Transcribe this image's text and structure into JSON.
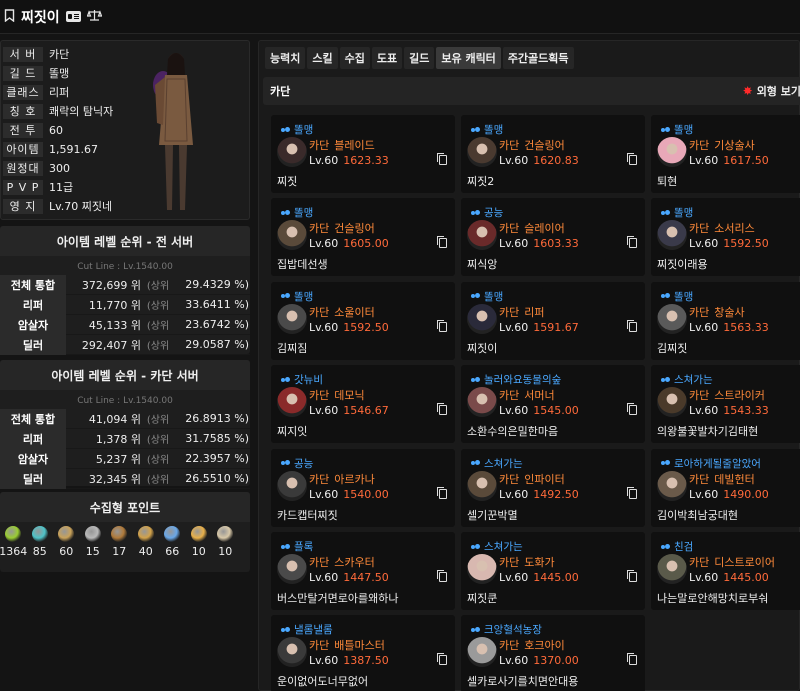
{
  "header": {
    "title": "찌짓이"
  },
  "profile": {
    "rows": [
      {
        "label": "서 버",
        "value": "카단"
      },
      {
        "label": "길 드",
        "value": "똘맹"
      },
      {
        "label": "클래스",
        "value": "리퍼"
      },
      {
        "label": "칭 호",
        "value": "쾌락의 탐닉자"
      },
      {
        "label": "전 투",
        "value": "60"
      },
      {
        "label": "아이템",
        "value": "1,591.67"
      },
      {
        "label": "원정대",
        "value": "300"
      },
      {
        "label": "P V P",
        "value": "11급"
      },
      {
        "label": "영 지",
        "value": "Lv.70 찌짓네"
      }
    ]
  },
  "rank_all": {
    "title": "아이템 레벨 순위 - 전 서버",
    "cutline": "Cut Line : Lv.1540.00",
    "rows": [
      {
        "label": "전체 통합",
        "pos": "372,699 위",
        "sang": "(상위",
        "pct": "29.4329 %)"
      },
      {
        "label": "리퍼",
        "pos": "11,770 위",
        "sang": "(상위",
        "pct": "33.6411 %)"
      },
      {
        "label": "암살자",
        "pos": "45,133 위",
        "sang": "(상위",
        "pct": "23.6742 %)"
      },
      {
        "label": "딜러",
        "pos": "292,407 위",
        "sang": "(상위",
        "pct": "29.0587 %)"
      }
    ]
  },
  "rank_server": {
    "title": "아이템 레벨 순위 - 카단 서버",
    "cutline": "Cut Line : Lv.1540.00",
    "rows": [
      {
        "label": "전체 통합",
        "pos": "41,094 위",
        "sang": "(상위",
        "pct": "26.8913 %)"
      },
      {
        "label": "리퍼",
        "pos": "1,378 위",
        "sang": "(상위",
        "pct": "31.7585 %)"
      },
      {
        "label": "암살자",
        "pos": "5,237 위",
        "sang": "(상위",
        "pct": "22.3957 %)"
      },
      {
        "label": "딜러",
        "pos": "32,345 위",
        "sang": "(상위",
        "pct": "26.5510 %)"
      }
    ]
  },
  "collect": {
    "title": "수집형 포인트",
    "items": [
      {
        "icon": "mokoko-seed-icon",
        "color": "#9acd32",
        "value": "1364"
      },
      {
        "icon": "island-heart-icon",
        "color": "#4fc3c8",
        "value": "85"
      },
      {
        "icon": "great-painting-icon",
        "color": "#c9a25a",
        "value": "60"
      },
      {
        "icon": "giant-heart-icon",
        "color": "#b9b9b9",
        "value": "15"
      },
      {
        "icon": "ignea-token-icon",
        "color": "#b07a3a",
        "value": "17"
      },
      {
        "icon": "voyage-ship-icon",
        "color": "#d2a24a",
        "value": "40"
      },
      {
        "icon": "world-tree-leaf-icon",
        "color": "#6aa8e8",
        "value": "66"
      },
      {
        "icon": "orpheus-star-icon",
        "color": "#e8b04a",
        "value": "10"
      },
      {
        "icon": "omnium-star-icon",
        "color": "#d8c8a8",
        "value": "10"
      }
    ]
  },
  "tabs": [
    "능력치",
    "스킬",
    "수집",
    "도표",
    "길드",
    "보유 캐릭터",
    "주간골드획득"
  ],
  "active_tab": "보유 캐릭터",
  "server_section": {
    "name": "카단",
    "danger_label": "외형 보기"
  },
  "characters": [
    {
      "guild": "똘맹",
      "server": "카단",
      "class": "블레이드",
      "level": "Lv.60",
      "ilvl": "1623.33",
      "name": "찌짓",
      "tone": "#3a2a2a"
    },
    {
      "guild": "똘맹",
      "server": "카단",
      "class": "건슬링어",
      "level": "Lv.60",
      "ilvl": "1620.83",
      "name": "찌짓2",
      "tone": "#4a3a30"
    },
    {
      "guild": "똘맹",
      "server": "카단",
      "class": "기상술사",
      "level": "Lv.60",
      "ilvl": "1617.50",
      "name": "퇴현",
      "tone": "#e8a8b8"
    },
    {
      "guild": "똘맹",
      "server": "카단",
      "class": "건슬링어",
      "level": "Lv.60",
      "ilvl": "1605.00",
      "name": "집밥데선생",
      "tone": "#5a4a3a"
    },
    {
      "guild": "공능",
      "server": "카단",
      "class": "슬레이어",
      "level": "Lv.60",
      "ilvl": "1603.33",
      "name": "찌식앙",
      "tone": "#6a2a2a"
    },
    {
      "guild": "똘맹",
      "server": "카단",
      "class": "소서리스",
      "level": "Lv.60",
      "ilvl": "1592.50",
      "name": "찌짓이래용",
      "tone": "#3a3a4a"
    },
    {
      "guild": "똘맹",
      "server": "카단",
      "class": "소울이터",
      "level": "Lv.60",
      "ilvl": "1592.50",
      "name": "김찌짐",
      "tone": "#4a4a4a"
    },
    {
      "guild": "똘맹",
      "server": "카단",
      "class": "리퍼",
      "level": "Lv.60",
      "ilvl": "1591.67",
      "name": "찌짓이",
      "tone": "#2a2a3a"
    },
    {
      "guild": "똘맹",
      "server": "카단",
      "class": "창술사",
      "level": "Lv.60",
      "ilvl": "1563.33",
      "name": "김찌짓",
      "tone": "#5a5a5a"
    },
    {
      "guild": "갓뉴비",
      "server": "카단",
      "class": "데모닉",
      "level": "Lv.60",
      "ilvl": "1546.67",
      "name": "찌지잇",
      "tone": "#8a2a2a"
    },
    {
      "guild": "놀러와요동물의숲",
      "server": "카단",
      "class": "서머너",
      "level": "Lv.60",
      "ilvl": "1545.00",
      "name": "소환수의은밀한마음",
      "tone": "#7a4a4a"
    },
    {
      "guild": "스쳐가는",
      "server": "카단",
      "class": "스트라이커",
      "level": "Lv.60",
      "ilvl": "1543.33",
      "name": "의왕불꽃발차기김태현",
      "tone": "#4a3a2a"
    },
    {
      "guild": "공능",
      "server": "카단",
      "class": "아르카나",
      "level": "Lv.60",
      "ilvl": "1540.00",
      "name": "카드캡터찌짓",
      "tone": "#3a3a3a"
    },
    {
      "guild": "스쳐가는",
      "server": "카단",
      "class": "인파이터",
      "level": "Lv.60",
      "ilvl": "1492.50",
      "name": "셀기꾼박멸",
      "tone": "#5a4a3a"
    },
    {
      "guild": "로아하게될줄알았어",
      "server": "카단",
      "class": "데빌헌터",
      "level": "Lv.60",
      "ilvl": "1490.00",
      "name": "김이박최남궁대현",
      "tone": "#6a5a4a"
    },
    {
      "guild": "플록",
      "server": "카단",
      "class": "스카우터",
      "level": "Lv.60",
      "ilvl": "1447.50",
      "name": "버스만탈거면로아를왜하나",
      "tone": "#4a4a4a"
    },
    {
      "guild": "스쳐가는",
      "server": "카단",
      "class": "도화가",
      "level": "Lv.60",
      "ilvl": "1445.00",
      "name": "찌짓쿤",
      "tone": "#d8b8b0"
    },
    {
      "guild": "친검",
      "server": "카단",
      "class": "디스트로이어",
      "level": "Lv.60",
      "ilvl": "1445.00",
      "name": "나는말로안해망치로부숴",
      "tone": "#5a5a4a"
    },
    {
      "guild": "낼롬낼롬",
      "server": "카단",
      "class": "배틀마스터",
      "level": "Lv.60",
      "ilvl": "1387.50",
      "name": "운이없어도너무없어",
      "tone": "#3a3a3a"
    },
    {
      "guild": "크앙혈석농장",
      "server": "카단",
      "class": "호크아이",
      "level": "Lv.60",
      "ilvl": "1370.00",
      "name": "셀카로사기를치면안대용",
      "tone": "#9a9a9a"
    }
  ]
}
